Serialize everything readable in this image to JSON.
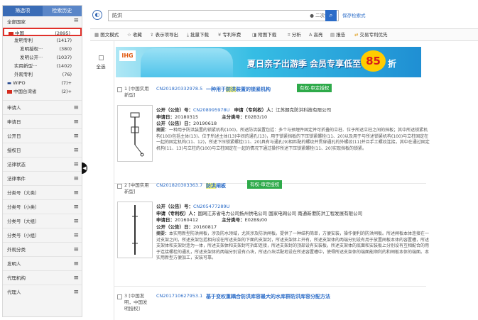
{
  "sidebar": {
    "tabs": [
      "筛选项",
      "检索历史"
    ],
    "country_header": "全部国家",
    "rows": [
      {
        "label": "中国",
        "count": "(2895)",
        "flag": true,
        "selected": true
      },
      {
        "label": "发明专利",
        "count": "(1417)",
        "indent": 2
      },
      {
        "label": "发明授权···",
        "count": "(380)",
        "indent": 3
      },
      {
        "label": "发明公开···",
        "count": "(1037)",
        "indent": 3
      },
      {
        "label": "实用新型···",
        "count": "(1402)",
        "indent": 2
      },
      {
        "label": "外观专利",
        "count": "(76)",
        "indent": 2
      },
      {
        "label": "WIPO",
        "count": "(7)+",
        "prefix": "▬"
      },
      {
        "label": "中国台湾省",
        "count": "(2)+",
        "flag": true
      }
    ],
    "sections": [
      "申请人",
      "申请日",
      "公开日",
      "授权日",
      "法律状态",
      "法律事件",
      "分类号（大类）",
      "分类号（小类）",
      "分类号（大组）",
      "分类号（小组）",
      "外观分类",
      "发明人",
      "代理机构",
      "代理人"
    ]
  },
  "search": {
    "query": "防洪",
    "secondary_label": "二次检索",
    "save_label": "保存检索式"
  },
  "toolbar": [
    "图文模式",
    "收藏",
    "表示项导出",
    "批量下载",
    "专利年费",
    "附图下载",
    "分析",
    "高亮",
    "报告",
    "交易专利优先"
  ],
  "select_all": "全选",
  "banner": {
    "brand": "IHG",
    "text": "夏日亲子出游季  会员专享低至",
    "badge": "85",
    "suffix": "折"
  },
  "results": [
    {
      "num": "1 [中国实用新型]",
      "id": "CN201820332978.5",
      "title_pre": "一种用于",
      "title_hl": "防洪",
      "title_post": "装置的锁紧机构",
      "status": "有权-审定授权",
      "pub_no": "CN208995978U",
      "applicant": "江苏朗克防洪科技有限公司",
      "app_date": "20180315",
      "ipc": "E02B3/10",
      "pub_date": "20190618",
      "abstract": "一种用于防洪装置的锁紧机构(100)，所述防洪装置包括：多个与预埋件固定并可折叠的立柱、位于所述立柱之间的挡板；其中所述锁紧机构(100)包括主体(13)、位于所述主体(13)中间的通孔(13)，用于锁紧挡板的下压锁紧螺栓(11、20)以及用于与所述锁紧机构(100)与立柱固定在一起的固定机构(11、12)，所述下压锁紧螺栓(11、20)具有与通孔(9)相匹配的螺纹并贯穿通孔的外螺纹(11)并且手工螺纹连接，其中在通过固定机构(11、13)与立柱的(100)与立柱固定在一起的情况下通过操作所述下压锁紧螺栓(11、20)实现挡板的锁紧。"
    },
    {
      "num": "2 [中国实用新型]",
      "id": "CN201820303363.7",
      "title_pre": "",
      "title_hl": "防洪",
      "title_post": "闸板",
      "status": "有权-审定授权",
      "pub_no": "CN205477289U",
      "applicant": "国网江苏省电力公司扬州供电公司 国家电网公司 南通新港防洪工程发展有限公司",
      "app_date": "20160412",
      "ipc": "E02B9/00",
      "pub_date": "20160817",
      "abstract": "本实用新型防洪闸板，涉及防水领域，尤其涉及防洪闸板。提供了一种结构简单，方便安装，操作便利的防洪闸板。所述闸板本体连接在一对支架之间，所述支架包括相向设在所述支架的下面的支架封，所述支架体上开有，所述支架体的两端分别设有用于放置闸板本体的容置槽，所述支架体和支架封连为一体，所述支架体和支架封可拆卸连接，所述支架封的顶部设有安装板，所述支架体的底面和安装板上分别设有互相配合的用于连接螺栓的通孔，所述支架体的两端分别设有凸块，所述凸块活配地设在所述容置槽中，使得所述支架体的端面能顺利的和闸板本体的端面。本实用新型方便加工，安装可靠。"
    },
    {
      "num": "3 [中国发明，中国发明授权]",
      "id": "CN201710627953.1",
      "title": "基于变权重耦合防洪库容最大的水库群防洪库容分配方法"
    }
  ]
}
